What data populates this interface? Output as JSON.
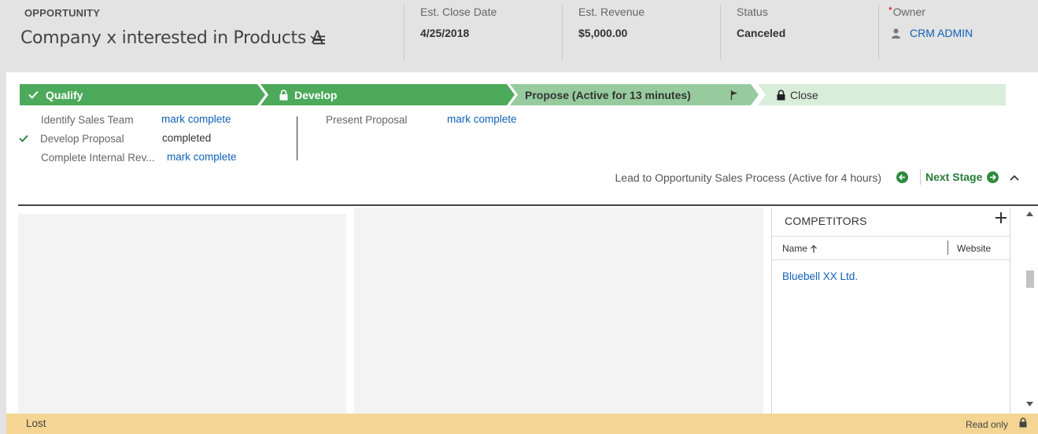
{
  "header": {
    "entity_type": "OPPORTUNITY",
    "record_title": "Company x interested in Products A",
    "fields": {
      "close_date_label": "Est. Close Date",
      "close_date_value": "4/25/2018",
      "revenue_label": "Est. Revenue",
      "revenue_value": "$5,000.00",
      "status_label": "Status",
      "status_value": "Canceled",
      "owner_required_mark": "*",
      "owner_label": "Owner",
      "owner_value": "CRM ADMIN"
    }
  },
  "process": {
    "stages": [
      {
        "label": "Qualify",
        "state": "completed",
        "icon": "check-icon"
      },
      {
        "label": "Develop",
        "state": "completed-locked",
        "icon": "lock-icon"
      },
      {
        "label": "Propose (Active for 13 minutes)",
        "state": "active",
        "icon": "flag-icon"
      },
      {
        "label": "Close",
        "state": "future",
        "icon": "lock-icon"
      }
    ],
    "steps_left": [
      {
        "name": "Identify Sales Team",
        "action": "mark complete",
        "done": false
      },
      {
        "name": "Develop Proposal",
        "action": "completed",
        "done": true
      },
      {
        "name": "Complete Internal Rev...",
        "action": "mark complete",
        "done": false
      }
    ],
    "steps_right": [
      {
        "name": "Present Proposal",
        "action": "mark complete",
        "done": false
      }
    ],
    "process_name": "Lead to Opportunity Sales Process (Active for 4 hours)",
    "next_stage_label": "Next Stage"
  },
  "competitors": {
    "title": "COMPETITORS",
    "columns": [
      "Name",
      "Website"
    ],
    "rows": [
      {
        "name": "Bluebell XX Ltd.",
        "website": ""
      }
    ]
  },
  "footer": {
    "status": "Lost",
    "read_only": "Read only"
  },
  "colors": {
    "stage_complete": "#4caa5a",
    "stage_active": "#97cb9e",
    "stage_future": "#d8edda",
    "link": "#1160b7",
    "footer_bg": "#f5d594"
  }
}
